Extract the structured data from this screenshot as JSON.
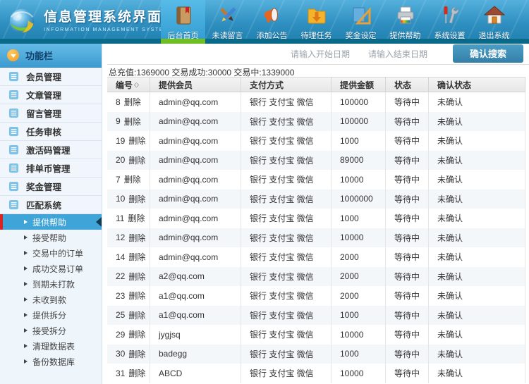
{
  "header": {
    "logo": {
      "title": "信息管理系统界面",
      "subtitle": "INFORMATION MANAGEMENT SYSTEM GUI"
    },
    "nav": [
      {
        "label": "后台首页",
        "icon": "book-icon",
        "active": true
      },
      {
        "label": "未读留言",
        "icon": "pen-brush-icon",
        "active": false
      },
      {
        "label": "添加公告",
        "icon": "megaphone-icon",
        "active": false
      },
      {
        "label": "待理任务",
        "icon": "folder-download-icon",
        "active": false
      },
      {
        "label": "奖金设定",
        "icon": "set-square-icon",
        "active": false
      },
      {
        "label": "提供帮助",
        "icon": "printer-icon",
        "active": false
      },
      {
        "label": "系统设置",
        "icon": "tools-icon",
        "active": false
      },
      {
        "label": "退出系统",
        "icon": "home-icon",
        "active": false
      }
    ]
  },
  "sidebar": {
    "header": {
      "label": "功能栏",
      "icon": "chevron-down-badge-icon"
    },
    "items": [
      {
        "label": "会员管理",
        "icon": "list-icon"
      },
      {
        "label": "文章管理",
        "icon": "edit-icon"
      },
      {
        "label": "留言管理",
        "icon": "edit-icon"
      },
      {
        "label": "任务审核",
        "icon": "edit-icon"
      },
      {
        "label": "激活码管理",
        "icon": "calendar-icon"
      },
      {
        "label": "排单币管理",
        "icon": "calendar-icon"
      },
      {
        "label": "奖金管理",
        "icon": "calendar-icon"
      },
      {
        "label": "匹配系统",
        "icon": "calendar-icon"
      }
    ],
    "submenu": [
      {
        "label": "提供帮助",
        "active": true
      },
      {
        "label": "接受帮助",
        "active": false
      },
      {
        "label": "交易中的订单",
        "active": false
      },
      {
        "label": "成功交易订单",
        "active": false
      },
      {
        "label": "到期未打款",
        "active": false
      },
      {
        "label": "未收到款",
        "active": false
      },
      {
        "label": "提供拆分",
        "active": false
      },
      {
        "label": "接受拆分",
        "active": false
      },
      {
        "label": "清理数据表",
        "active": false
      },
      {
        "label": "备份数据库",
        "active": false
      }
    ]
  },
  "search": {
    "keyword_value": "",
    "start_placeholder": "请输入开始日期",
    "end_placeholder": "请输入结束日期",
    "button_label": "确认搜索"
  },
  "stats": "总充值:1369000 交易成功:30000 交易中:1339000",
  "table": {
    "columns": [
      "编号",
      "提供会员",
      "支付方式",
      "提供金额",
      "状态",
      "确认状态"
    ],
    "sort_glyph": "◇",
    "delete_label": "删除",
    "rows": [
      {
        "id": "8",
        "member": "admin@qq.com",
        "payment": "银行 支付宝 微信",
        "amount": "100000",
        "status": "等待中",
        "confirm": "未确认"
      },
      {
        "id": "9",
        "member": "admin@qq.com",
        "payment": "银行 支付宝 微信",
        "amount": "100000",
        "status": "等待中",
        "confirm": "未确认"
      },
      {
        "id": "19",
        "member": "admin@qq.com",
        "payment": "银行 支付宝 微信",
        "amount": "1000",
        "status": "等待中",
        "confirm": "未确认"
      },
      {
        "id": "20",
        "member": "admin@qq.com",
        "payment": "银行 支付宝 微信",
        "amount": "89000",
        "status": "等待中",
        "confirm": "未确认"
      },
      {
        "id": "7",
        "member": "admin@qq.com",
        "payment": "银行 支付宝 微信",
        "amount": "10000",
        "status": "等待中",
        "confirm": "未确认"
      },
      {
        "id": "10",
        "member": "admin@qq.com",
        "payment": "银行 支付宝 微信",
        "amount": "1000000",
        "status": "等待中",
        "confirm": "未确认"
      },
      {
        "id": "11",
        "member": "admin@qq.com",
        "payment": "银行 支付宝 微信",
        "amount": "1000",
        "status": "等待中",
        "confirm": "未确认"
      },
      {
        "id": "12",
        "member": "admin@qq.com",
        "payment": "银行 支付宝 微信",
        "amount": "10000",
        "status": "等待中",
        "confirm": "未确认"
      },
      {
        "id": "14",
        "member": "admin@qq.com",
        "payment": "银行 支付宝 微信",
        "amount": "2000",
        "status": "等待中",
        "confirm": "未确认"
      },
      {
        "id": "22",
        "member": "a2@qq.com",
        "payment": "银行 支付宝 微信",
        "amount": "2000",
        "status": "等待中",
        "confirm": "未确认"
      },
      {
        "id": "23",
        "member": "a1@qq.com",
        "payment": "银行 支付宝 微信",
        "amount": "2000",
        "status": "等待中",
        "confirm": "未确认"
      },
      {
        "id": "25",
        "member": "a1@qq.com",
        "payment": "银行 支付宝 微信",
        "amount": "1000",
        "status": "等待中",
        "confirm": "未确认"
      },
      {
        "id": "29",
        "member": "jygjsq",
        "payment": "银行 支付宝 微信",
        "amount": "10000",
        "status": "等待中",
        "confirm": "未确认"
      },
      {
        "id": "30",
        "member": "badegg",
        "payment": "银行 支付宝 微信",
        "amount": "1000",
        "status": "等待中",
        "confirm": "未确认"
      },
      {
        "id": "31",
        "member": "ABCD",
        "payment": "银行 支付宝 微信",
        "amount": "10000",
        "status": "等待中",
        "confirm": "未确认"
      }
    ]
  },
  "colors": {
    "header_blue": "#2e8fc0",
    "header_strip_teal": "#0a6a8a",
    "active_nav_underline_green": "#6fbf22",
    "sidebar_header_blue": "#3d9bd0",
    "submenu_active_blue": "#3fa5d8",
    "submenu_active_red_bar": "#dd2222",
    "search_button_blue": "#357fa8",
    "zebra_row": "#f3f7fa"
  }
}
